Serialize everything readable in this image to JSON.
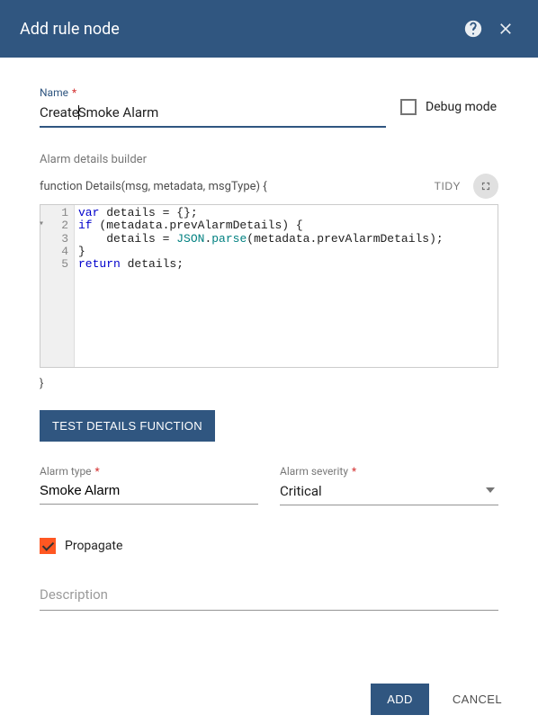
{
  "modal": {
    "title": "Add rule node",
    "help_icon": "help-icon",
    "close_icon": "close-icon"
  },
  "name_field": {
    "label": "Name",
    "required_marker": "*",
    "value_before_caret": "Create",
    "value_after_caret": " Smoke Alarm"
  },
  "debug_mode": {
    "label": "Debug mode",
    "checked": false
  },
  "details_builder": {
    "subtitle": "Alarm details builder",
    "signature": "function Details(msg, metadata, msgType) {",
    "tidy_label": "TIDY",
    "close_brace": "}",
    "code_lines": [
      "var details = {};",
      "if (metadata.prevAlarmDetails) {",
      "    details = JSON.parse(metadata.prevAlarmDetails);",
      "}",
      "return details;"
    ],
    "test_button": "TEST DETAILS FUNCTION"
  },
  "alarm_type": {
    "label": "Alarm type",
    "required_marker": "*",
    "value": "Smoke Alarm"
  },
  "alarm_severity": {
    "label": "Alarm severity",
    "required_marker": "*",
    "value": "Critical"
  },
  "propagate": {
    "label": "Propagate",
    "checked": true
  },
  "description": {
    "placeholder": "Description",
    "value": ""
  },
  "footer": {
    "add": "ADD",
    "cancel": "CANCEL"
  }
}
